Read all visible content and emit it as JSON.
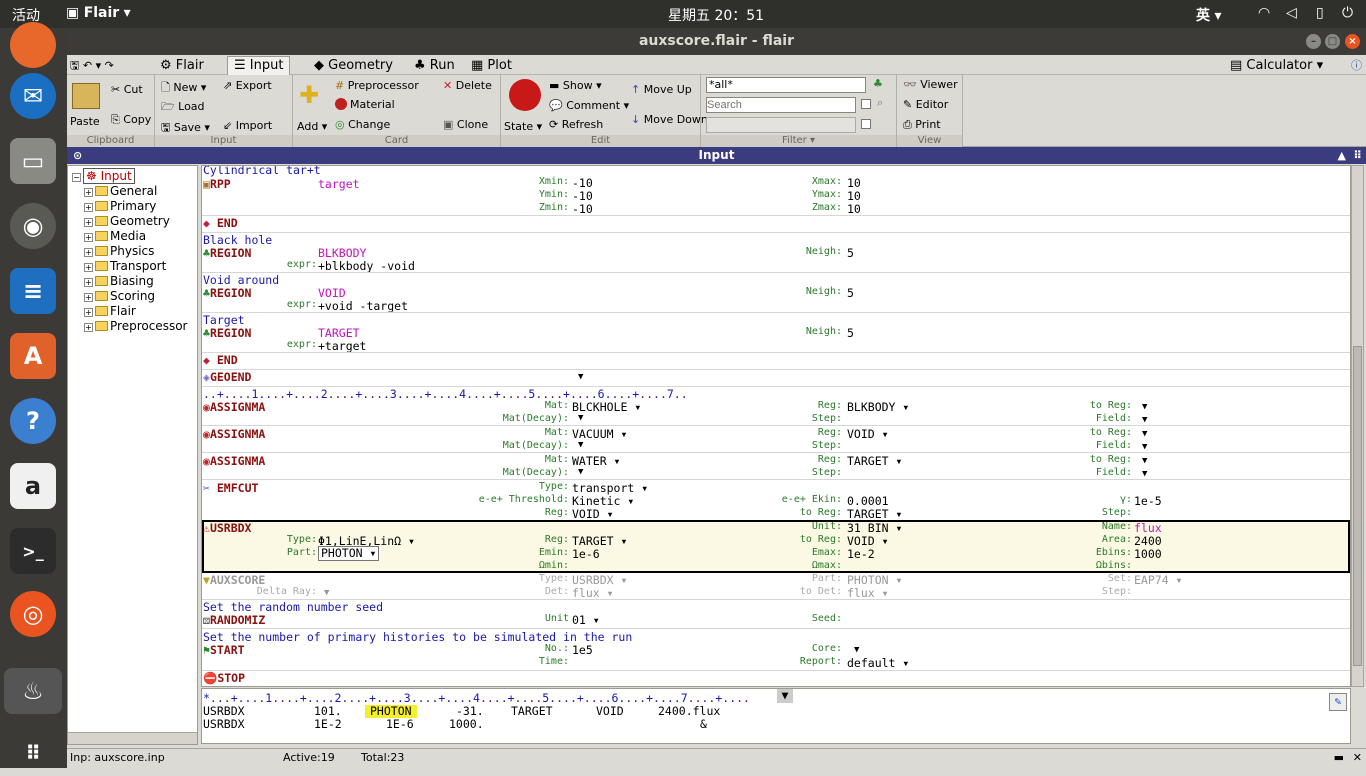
{
  "topbar": {
    "activities": "活动",
    "app": "Flair",
    "clock": "星期五 20：51",
    "ime": "英"
  },
  "window": {
    "title": "auxscore.flair - flair"
  },
  "tabs": [
    "Flair",
    "Input",
    "Geometry",
    "Run",
    "Plot"
  ],
  "calculator": "Calculator",
  "ribbon": {
    "clipboard": {
      "paste": "Paste",
      "cut": "Cut",
      "copy": "Copy",
      "label": "Clipboard"
    },
    "input": {
      "new": "New",
      "load": "Load",
      "save": "Save",
      "export": "Export",
      "import": "Import",
      "label": "Input"
    },
    "card": {
      "add": "Add",
      "preprocessor": "Preprocessor",
      "material": "Material",
      "change": "Change",
      "delete": "Delete",
      "clone": "Clone",
      "label": "Card"
    },
    "edit": {
      "state": "State",
      "show": "Show",
      "comment": "Comment",
      "refresh": "Refresh",
      "move_up": "Move Up",
      "move_down": "Move Down",
      "label": "Edit"
    },
    "filter": {
      "value": "*all*",
      "search_placeholder": "Search",
      "label": "Filter"
    },
    "view": {
      "viewer": "Viewer",
      "editor": "Editor",
      "print": "Print",
      "label": "View"
    }
  },
  "panel_title": "Input",
  "tree": [
    "Input",
    "General",
    "Primary",
    "Geometry",
    "Media",
    "Physics",
    "Transport",
    "Biasing",
    "Scoring",
    "Flair",
    "Preprocessor"
  ],
  "editor": {
    "ruler_top": "..+....1....+....2....+....3....+....4....+....5....+....6....+....7..",
    "cylindrical": "Cylindrical tar",
    "rpp": {
      "name": "RPP",
      "id": "target",
      "xmin_l": "Xmin:",
      "xmin": "-10",
      "ymin_l": "Ymin:",
      "ymin": "-10",
      "zmin_l": "Zmin:",
      "zmin": "-10",
      "xmax_l": "Xmax:",
      "xmax": "10",
      "ymax_l": "Ymax:",
      "ymax": "10",
      "zmax_l": "Zmax:",
      "zmax": "10"
    },
    "end": "END",
    "regions": [
      {
        "comment": "Black hole",
        "name": "BLKBODY",
        "expr": "+blkbody -void",
        "neigh": "5"
      },
      {
        "comment": "Void around",
        "name": "VOID",
        "expr": "+void -target",
        "neigh": "5"
      },
      {
        "comment": "Target",
        "name": "TARGET",
        "expr": "+target",
        "neigh": "5"
      }
    ],
    "region_kw": "REGION",
    "expr_l": "expr:",
    "neigh_l": "Neigh:",
    "geoend": "GEOEND",
    "assignma_kw": "ASSIGNMA",
    "assignma": [
      {
        "mat": "BLCKHOLE",
        "reg": "BLKBODY"
      },
      {
        "mat": "VACUUM",
        "reg": "VOID"
      },
      {
        "mat": "WATER",
        "reg": "TARGET"
      }
    ],
    "lbl": {
      "mat": "Mat:",
      "matdecay": "Mat(Decay):",
      "reg": "Reg:",
      "step": "Step:",
      "toreg": "to Reg:",
      "field": "Field:"
    },
    "emfcut": {
      "name": "EMFCUT",
      "type_l": "Type:",
      "type": "transport",
      "thr_l": "e-e+ Threshold:",
      "thr": "Kinetic",
      "reg_l": "Reg:",
      "reg": "VOID",
      "ekin_l": "e-e+ Ekin:",
      "ekin": "0.0001",
      "toreg_l": "to Reg:",
      "toreg": "TARGET",
      "gamma_l": "γ:",
      "gamma": "1e-5",
      "step_l": "Step:"
    },
    "usrbdx": {
      "name": "USRBDX",
      "type_l": "Type:",
      "type": "Φ1,LinE,LinΩ",
      "part_l": "Part:",
      "part": "PHOTON",
      "reg_l": "Reg:",
      "reg": "TARGET",
      "emin_l": "Emin:",
      "emin": "1e-6",
      "omin_l": "Ωmin:",
      "unit_l": "Unit:",
      "unit": "31 BIN",
      "toreg_l": "to Reg:",
      "toreg": "VOID",
      "emax_l": "Emax:",
      "emax": "1e-2",
      "omax_l": "Ωmax:",
      "name_l": "Name:",
      "nm": "flux",
      "area_l": "Area:",
      "area": "2400",
      "ebins_l": "Ebins:",
      "ebins": "1000",
      "obins_l": "Ωbins:"
    },
    "auxscore": {
      "name": "AUXSCORE",
      "type_l": "Type:",
      "type": "USRBDX",
      "delta_l": "Delta Ray:",
      "det_l": "Det:",
      "det": "flux",
      "part_l": "Part:",
      "part": "PHOTON",
      "todet_l": "to Det:",
      "todet": "flux",
      "set_l": "Set:",
      "set": "EAP74",
      "step_l": "Step:"
    },
    "randomiz": {
      "comment": "Set the random number seed",
      "name": "RANDOMIZ",
      "unit_l": "Unit",
      "unit": "01",
      "seed_l": "Seed:"
    },
    "start": {
      "comment": "Set the number of primary histories to be simulated in the run",
      "name": "START",
      "no_l": "No.:",
      "no": "1e5",
      "time_l": "Time:",
      "core_l": "Core:",
      "report_l": "Report:",
      "report": "default"
    },
    "stop": "STOP"
  },
  "bottom": {
    "ruler": "*...+....1....+....2....+....3....+....4....+....5....+....6....+....7....+....",
    "line1": [
      "USRBDX",
      "101.",
      "PHOTON",
      "-31.",
      "TARGET",
      "VOID",
      "2400.flux"
    ],
    "line2": [
      "USRBDX",
      "1E-2",
      "1E-6",
      "1000.",
      "&"
    ]
  },
  "status": {
    "file": "Inp: auxscore.inp",
    "active": "Active:19",
    "total": "Total:23"
  }
}
